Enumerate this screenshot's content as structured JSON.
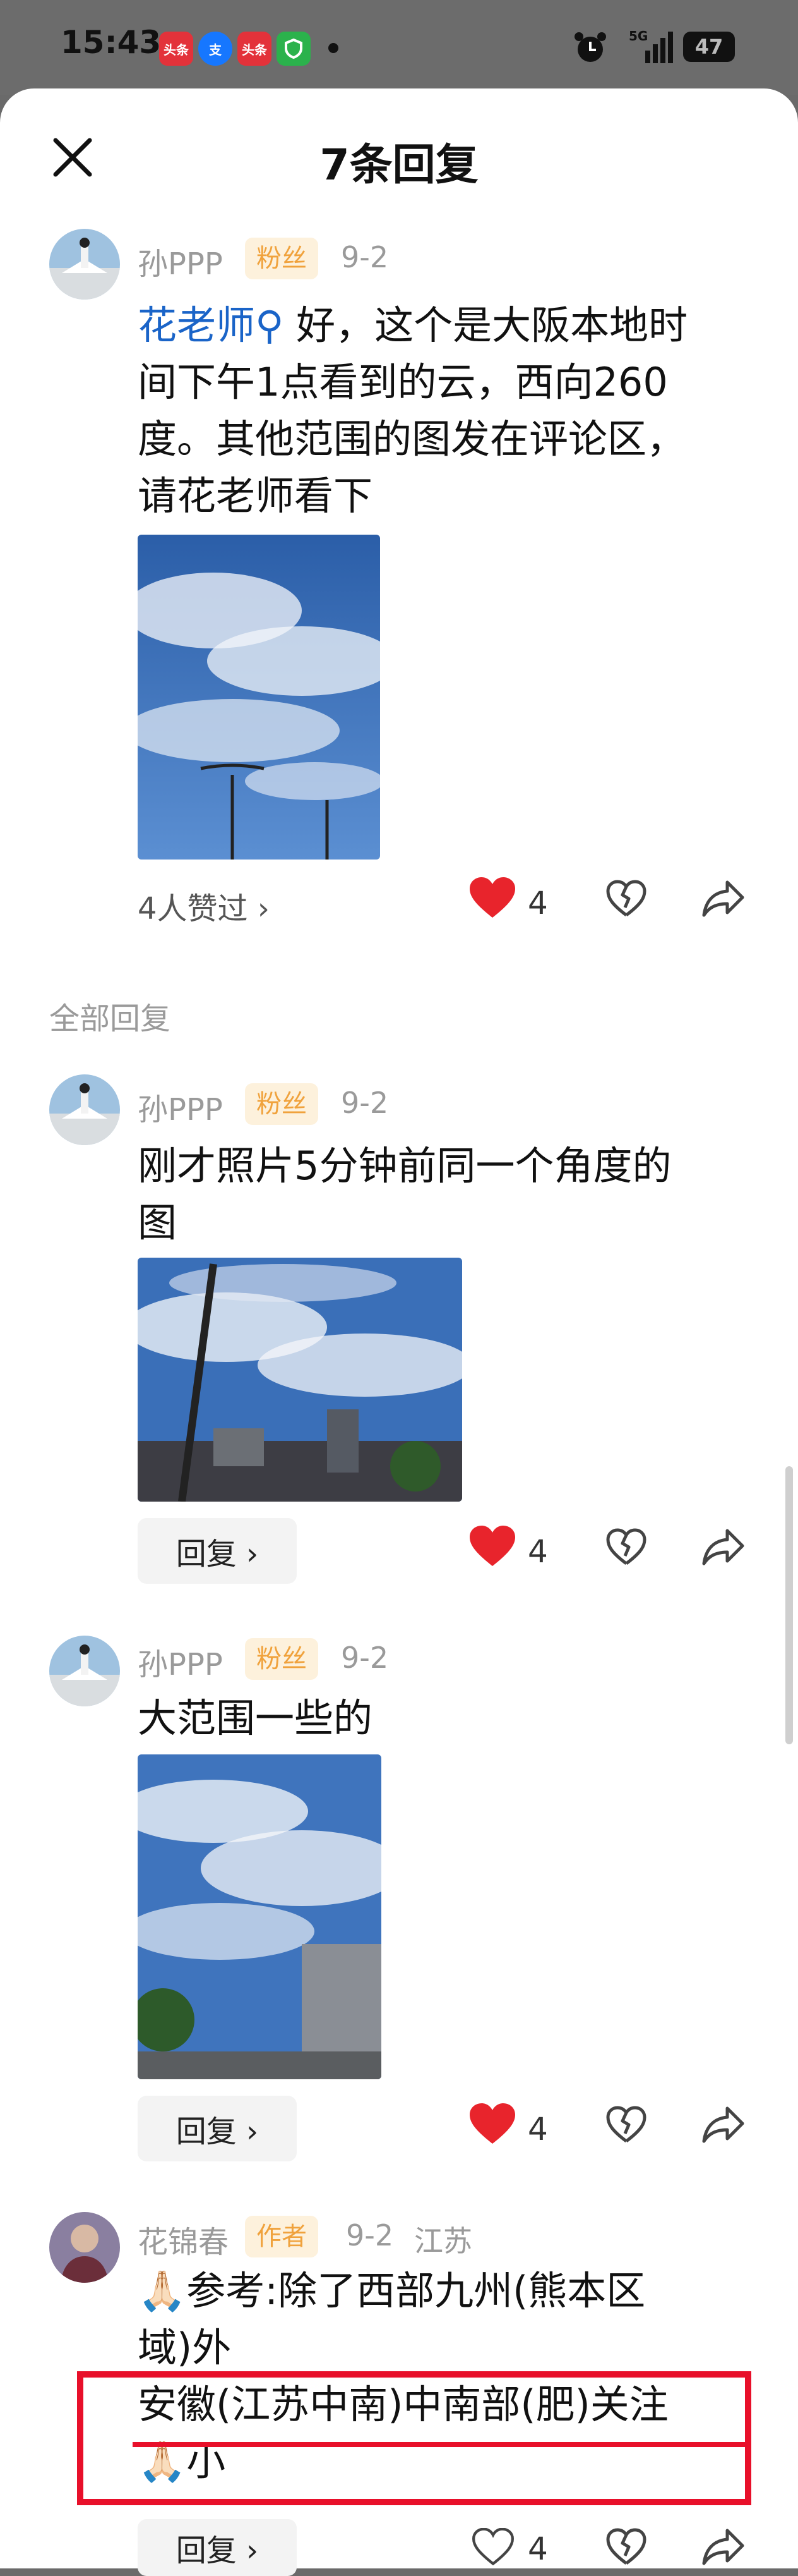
{
  "status_bar": {
    "time": "15:43",
    "apps": [
      {
        "icon": "toutiao-app-icon",
        "label": "头条",
        "color": "#e3323a"
      },
      {
        "icon": "alipay-app-icon",
        "label": "支",
        "color": "#1677ff"
      },
      {
        "icon": "toutiao-app-icon",
        "label": "头条",
        "color": "#e3323a"
      },
      {
        "icon": "shield-app-icon",
        "label": "",
        "color": "#2bb24c"
      }
    ],
    "network": "5G",
    "battery": "47"
  },
  "header": {
    "title": "7条回复"
  },
  "main_comment": {
    "user": "孙PPP",
    "badge": "粉丝",
    "date": "9-2",
    "mention": "花老师",
    "lines": [
      "好，这个是大阪本地时",
      "间下午1点看到的云，西向260",
      "度。其他范围的图发在评论区，",
      "请花老师看下"
    ],
    "likes_text": "4人赞过 ›",
    "like_count": "4"
  },
  "section_label": "全部回复",
  "replies": [
    {
      "user": "孙PPP",
      "badge": "粉丝",
      "date": "9-2",
      "lines": [
        "刚才照片5分钟前同一个角度的",
        "图"
      ],
      "reply_label": "回复 ›",
      "like_count": "4"
    },
    {
      "user": "孙PPP",
      "badge": "粉丝",
      "date": "9-2",
      "lines": [
        "大范围一些的"
      ],
      "reply_label": "回复 ›",
      "like_count": "4"
    },
    {
      "user": "花锦春",
      "badge": "作者",
      "date": "9-2",
      "location": "江苏",
      "lines": [
        "🙏🏻参考:除了西部九州(熊本区",
        "域)外",
        "安徽(江苏中南)中南部(肥)关注",
        "🙏🏻小"
      ],
      "reply_label": "回复 ›",
      "like_count": "4"
    }
  ],
  "colors": {
    "like_red": "#e8242c",
    "mention_blue": "#1a64c8",
    "badge_orange": "#f0a23c",
    "highlight_red": "#e8102a"
  }
}
